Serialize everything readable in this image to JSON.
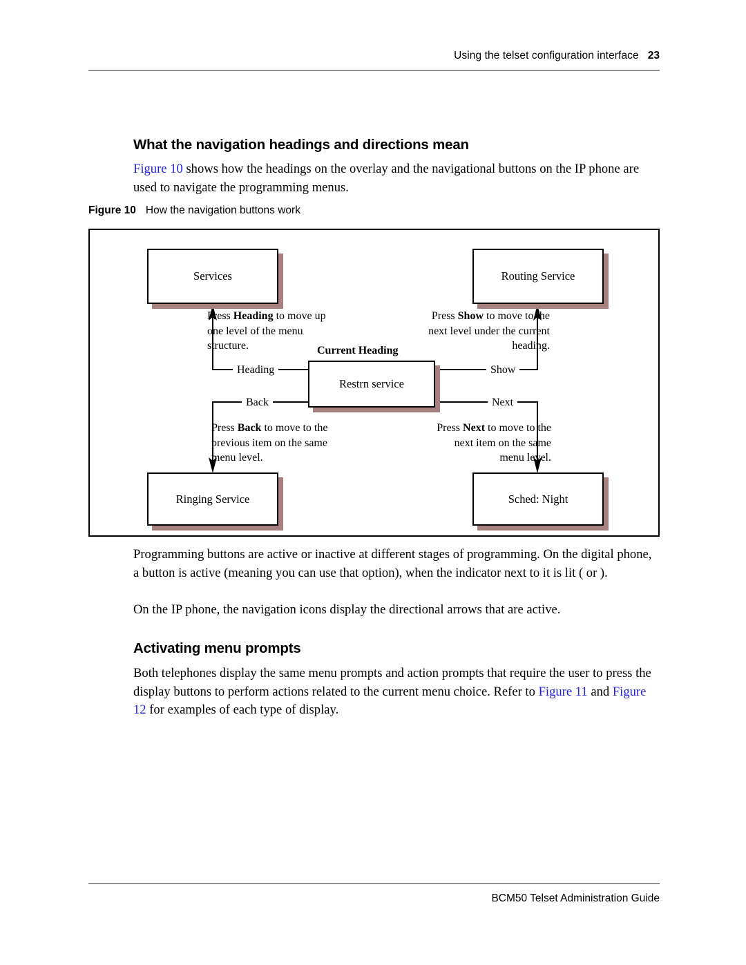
{
  "header": {
    "title": "Using the telset configuration interface",
    "page_number": "23"
  },
  "footer": {
    "guide_title": "BCM50 Telset Administration Guide"
  },
  "sections": [
    {
      "heading": "What the navigation headings and directions mean",
      "paragraph_prefix_link": "Figure 10",
      "paragraph_rest": " shows how the headings on the overlay and the navigational buttons on the IP phone are used to navigate the programming menus."
    },
    {
      "heading": "Activating menu prompts"
    }
  ],
  "figure": {
    "caption_number": "Figure 10",
    "caption_text": "How the navigation buttons work",
    "nodes": {
      "top_left": "Services",
      "top_right": "Routing Service",
      "center": "Restrn service",
      "bottom_left": "Ringing Service",
      "bottom_right": "Sched: Night"
    },
    "center_label": "Current Heading",
    "connector_labels": {
      "heading": "Heading",
      "back": "Back",
      "show": "Show",
      "next": "Next"
    },
    "callouts": {
      "heading": {
        "pre": "Press ",
        "key": "Heading",
        "post": " to move up one level of the menu structure."
      },
      "show": {
        "pre": "Press ",
        "key": "Show",
        "post": " to move to the next level under the current heading."
      },
      "back": {
        "pre": "Press ",
        "key": "Back",
        "post": " to move to the previous item on the same menu level."
      },
      "next": {
        "pre": "Press ",
        "key": "Next",
        "post": " to move to the next item on the same menu level."
      }
    },
    "shadow_color": "#a78080",
    "border_color": "#000000"
  },
  "body": {
    "para_active": "Programming buttons are active or inactive at different stages of programming. On the digital phone, a button is active (meaning you can use that option), when the indicator next to it is lit (    or    ).",
    "para_ip_phone": "On the IP phone, the navigation icons display the directional arrows that are active.",
    "para_prompts_part1": "Both telephones display the same menu prompts and action prompts that require the user to press the display buttons to perform actions related to the current menu choice. Refer to ",
    "para_prompts_link1": "Figure 11",
    "para_prompts_part2": " and ",
    "para_prompts_link2": "Figure 12",
    "para_prompts_part3": " for examples of each type of display."
  },
  "colors": {
    "link": "#2222dd",
    "header_rule": "#929292",
    "footer_rule": "#2b2b2b"
  }
}
